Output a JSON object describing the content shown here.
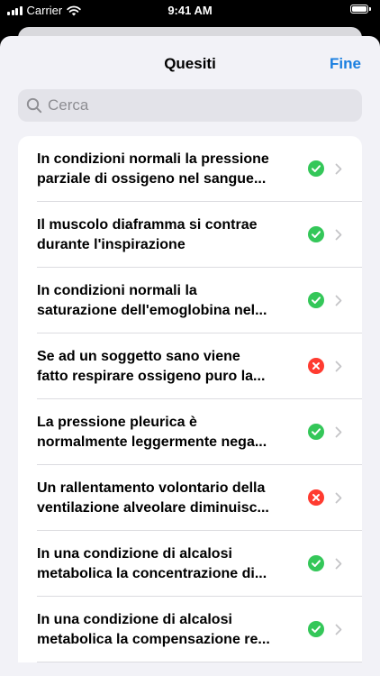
{
  "status_bar": {
    "carrier": "Carrier",
    "time": "9:41 AM"
  },
  "nav": {
    "title": "Quesiti",
    "done_label": "Fine",
    "accent_color": "#1a7fe0"
  },
  "search": {
    "placeholder": "Cerca",
    "value": ""
  },
  "colors": {
    "correct": "#34c759",
    "wrong": "#ff3b30"
  },
  "questions": [
    {
      "lines": [
        "In condizioni normali la pressione",
        "parziale di ossigeno nel sangue..."
      ],
      "status": "correct",
      "status_icon": "checkmark-circle-icon"
    },
    {
      "lines": [
        "Il muscolo diaframma si contrae",
        "durante l'inspirazione"
      ],
      "status": "correct",
      "status_icon": "checkmark-circle-icon"
    },
    {
      "lines": [
        "In condizioni normali la",
        "saturazione dell'emoglobina nel..."
      ],
      "status": "correct",
      "status_icon": "checkmark-circle-icon"
    },
    {
      "lines": [
        "Se ad un soggetto sano viene",
        "fatto respirare ossigeno puro la..."
      ],
      "status": "wrong",
      "status_icon": "xmark-circle-icon"
    },
    {
      "lines": [
        "La pressione pleurica è",
        "normalmente leggermente nega..."
      ],
      "status": "correct",
      "status_icon": "checkmark-circle-icon"
    },
    {
      "lines": [
        "Un rallentamento volontario della",
        "ventilazione alveolare diminuisc..."
      ],
      "status": "wrong",
      "status_icon": "xmark-circle-icon"
    },
    {
      "lines": [
        "In una condizione di alcalosi",
        "metabolica la concentrazione di..."
      ],
      "status": "correct",
      "status_icon": "checkmark-circle-icon"
    },
    {
      "lines": [
        "In una condizione di alcalosi",
        "metabolica la compensazione re..."
      ],
      "status": "correct",
      "status_icon": "checkmark-circle-icon"
    }
  ]
}
